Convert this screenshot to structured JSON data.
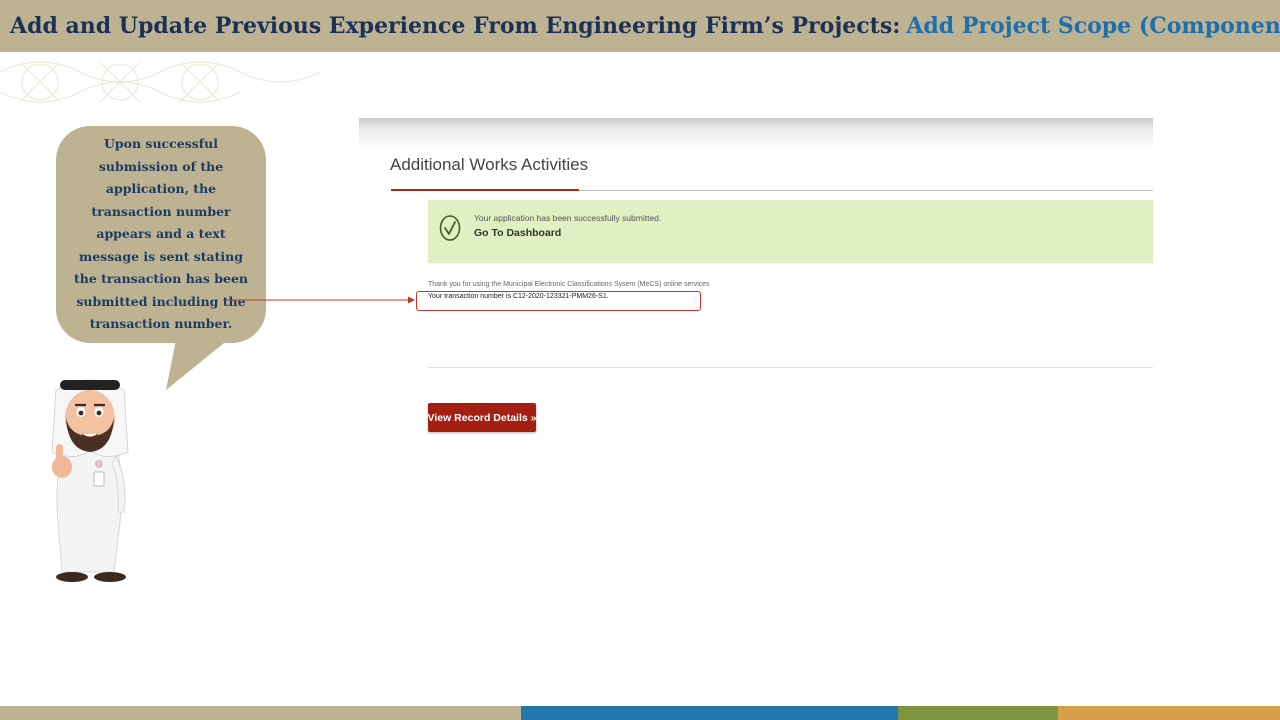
{
  "slide": {
    "title_main": "Add and Update Previous Experience From Engineering Firm’s Projects:",
    "title_accent": "Add Project Scope (Component)",
    "colors": {
      "title_bar": "#bdb392",
      "title_main": "#1d3157",
      "title_accent": "#1f6fae",
      "bottom_bar": [
        "#bdb392",
        "#2377ad",
        "#7e9440",
        "#d59f48"
      ]
    }
  },
  "callout": {
    "text": "Upon successful submission of the application, the transaction number appears and a text message is sent stating the transaction has been submitted including the transaction number."
  },
  "ui": {
    "heading": "Additional Works Activities",
    "success": {
      "icon": "check-circle-icon",
      "message": "Your application has been successfully submitted.",
      "link_label": "Go To Dashboard"
    },
    "thanks_text": "Thank you for using the Municipal Electronic Classifications Sysem (MeCS) online services",
    "transaction_text": "Your transaction number is C12-2020-123321-PMM26-S1.",
    "view_button_label": "View Record Details »",
    "colors": {
      "accent": "#a31f12",
      "success_bg": "#dff0c2"
    }
  }
}
